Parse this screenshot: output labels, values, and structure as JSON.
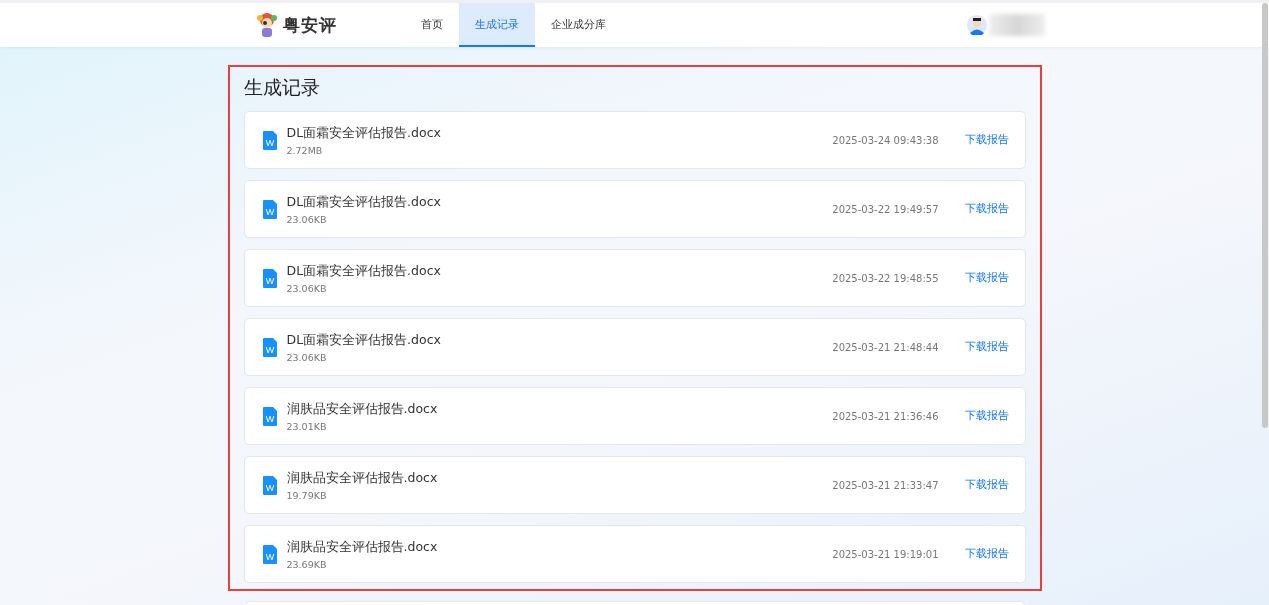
{
  "header": {
    "brand": "粤安评",
    "nav": [
      {
        "label": "首页",
        "selected": false
      },
      {
        "label": "生成记录",
        "selected": true
      },
      {
        "label": "企业成分库",
        "selected": false
      }
    ]
  },
  "page": {
    "title": "生成记录",
    "records": [
      {
        "icon_letter": "W",
        "file": "DL面霜安全评估报告.docx",
        "size": "2.72MB",
        "time": "2025-03-24 09:43:38",
        "action": "下载报告"
      },
      {
        "icon_letter": "W",
        "file": "DL面霜安全评估报告.docx",
        "size": "23.06KB",
        "time": "2025-03-22 19:49:57",
        "action": "下载报告"
      },
      {
        "icon_letter": "W",
        "file": "DL面霜安全评估报告.docx",
        "size": "23.06KB",
        "time": "2025-03-22 19:48:55",
        "action": "下载报告"
      },
      {
        "icon_letter": "W",
        "file": "DL面霜安全评估报告.docx",
        "size": "23.06KB",
        "time": "2025-03-21 21:48:44",
        "action": "下载报告"
      },
      {
        "icon_letter": "W",
        "file": "润肤品安全评估报告.docx",
        "size": "23.01KB",
        "time": "2025-03-21 21:36:46",
        "action": "下载报告"
      },
      {
        "icon_letter": "W",
        "file": "润肤品安全评估报告.docx",
        "size": "19.79KB",
        "time": "2025-03-21 21:33:47",
        "action": "下载报告"
      },
      {
        "icon_letter": "W",
        "file": "润肤品安全评估报告.docx",
        "size": "23.69KB",
        "time": "2025-03-21 19:19:01",
        "action": "下载报告"
      }
    ]
  }
}
